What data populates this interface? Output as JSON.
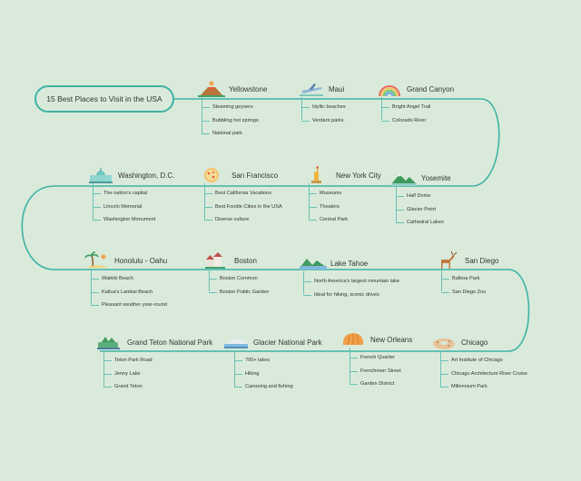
{
  "title": "15 Best Places to Visit in the USA",
  "colors": {
    "background": "#d9eadb",
    "path": "#3fb3a4",
    "branch": "#6cc0b4"
  },
  "places": [
    {
      "name": "Yellowstone",
      "icon": "volcano-icon",
      "items": [
        "Steaming geysers",
        "Bubbling hot springs",
        "National park"
      ]
    },
    {
      "name": "Maui",
      "icon": "plane-island-icon",
      "items": [
        "Idyllic beaches",
        "Verdant parks"
      ]
    },
    {
      "name": "Grand Canyon",
      "icon": "rainbow-icon",
      "items": [
        "Bright Angel Trail",
        "Colorado River"
      ]
    },
    {
      "name": "Washington, D.C.",
      "icon": "capitol-icon",
      "items": [
        "The nation's capital",
        "Lincoln Memorial",
        "Washington Monument"
      ]
    },
    {
      "name": "San Francisco",
      "icon": "pizza-icon",
      "items": [
        "Best California Vacations",
        "Best Foodie Cities in the USA",
        "Diverse culture"
      ]
    },
    {
      "name": "New York City",
      "icon": "statue-of-liberty-icon",
      "items": [
        "Museums",
        "Theaters",
        "Central Park"
      ]
    },
    {
      "name": "Yosemite",
      "icon": "mountain-icon",
      "items": [
        "Half Dome",
        "Glacier Point",
        "Cathedral Lakes"
      ]
    },
    {
      "name": "Honolulu - Oahu",
      "icon": "palm-beach-icon",
      "items": [
        "Waikiki Beach",
        "Kailua's Lanikai Beach",
        "Pleasant weather year-round"
      ]
    },
    {
      "name": "Boston",
      "icon": "town-icon",
      "items": [
        "Boston Common",
        "Boston Public Garden"
      ]
    },
    {
      "name": "Lake Tahoe",
      "icon": "lake-icon",
      "items": [
        "North America's largest mountain lake",
        "Ideal for hiking, scenic drives"
      ]
    },
    {
      "name": "San Diego",
      "icon": "deer-icon",
      "items": [
        "Balboa Park",
        "San Diego Zoo"
      ]
    },
    {
      "name": "Grand Teton National Park",
      "icon": "park-icon",
      "items": [
        "Teton Park Road",
        "Jenny Lake",
        "Grand Teton"
      ]
    },
    {
      "name": "Glacier National Park",
      "icon": "glacier-icon",
      "items": [
        "700+ lakes",
        "Hiking",
        "Canoeing and fishing"
      ]
    },
    {
      "name": "New Orleans",
      "icon": "shell-icon",
      "items": [
        "French Quarter",
        "Frenchmen Street",
        "Garden District"
      ]
    },
    {
      "name": "Chicago",
      "icon": "bagel-icon",
      "items": [
        "Art Institute of Chicago",
        "Chicago Architecture River Cruise",
        "Millennium Park"
      ]
    }
  ]
}
